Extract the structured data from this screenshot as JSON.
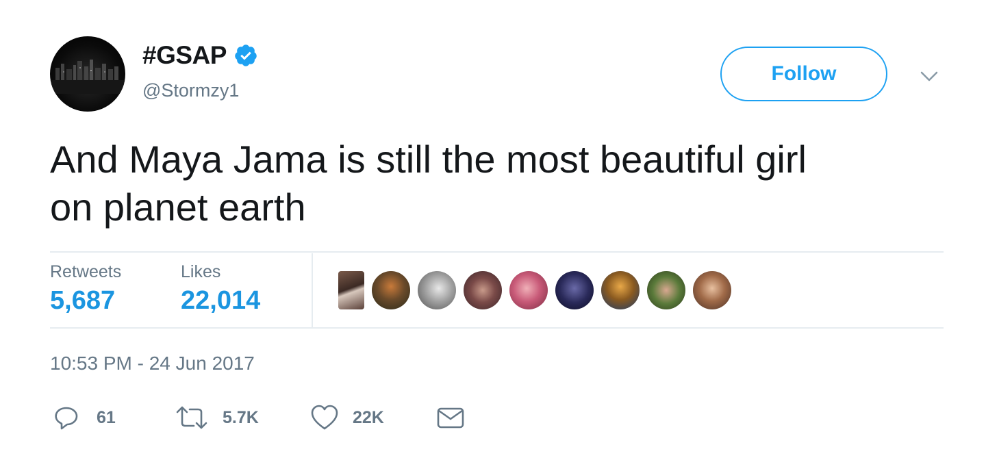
{
  "author": {
    "display_name": "#GSAP",
    "handle": "@Stormzy1",
    "verified": true
  },
  "header": {
    "follow_label": "Follow"
  },
  "tweet": {
    "text_line1": "And Maya Jama is still the most beautiful girl",
    "text_line2": "on planet earth",
    "timestamp": "10:53 PM - 24 Jun 2017"
  },
  "stats": {
    "retweets_label": "Retweets",
    "retweets_value": "5,687",
    "likes_label": "Likes",
    "likes_value": "22,014"
  },
  "actions": {
    "reply_count": "61",
    "retweet_count": "5.7K",
    "like_count": "22K"
  },
  "icons": {
    "verified": "verified-badge-icon",
    "menu": "chevron-down-icon",
    "reply": "reply-icon",
    "retweet": "retweet-icon",
    "like": "heart-icon",
    "message": "envelope-icon"
  },
  "colors": {
    "accent": "#1da1f2",
    "stat_value": "#1b95e0",
    "secondary_text": "#657786",
    "divider": "#e6ecf0",
    "primary_text": "#14171a"
  }
}
